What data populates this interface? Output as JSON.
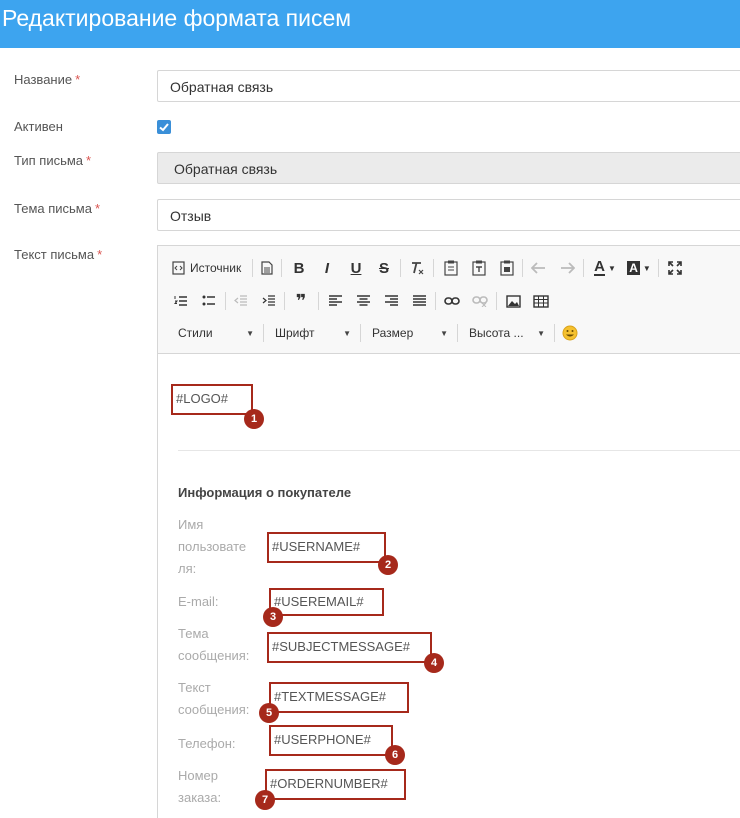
{
  "page": {
    "title": "Редактирование формата писем"
  },
  "form": {
    "name_label": "Название",
    "name_value": "Обратная связь",
    "active_label": "Активен",
    "active_checked": true,
    "type_label": "Тип письма",
    "type_value": "Обратная связь",
    "subject_label": "Тема письма",
    "subject_value": "Отзыв",
    "body_label": "Текст письма",
    "required_mark": "*"
  },
  "editor": {
    "toolbar": {
      "source_label": "Источник",
      "styles_label": "Стили",
      "font_label": "Шрифт",
      "size_label": "Размер",
      "height_label": "Высота ...",
      "bold": "B",
      "italic": "I",
      "underline": "U",
      "strike": "S",
      "quote": "❞",
      "text_color": "A",
      "bg_color": "A",
      "accent_color": "#3da4ef"
    },
    "content": {
      "logo": "#LOGO#",
      "section_title": "Информация о покупателе",
      "rows": [
        {
          "label_lines": [
            "Имя",
            "пользовате",
            "ля:"
          ],
          "placeholder": "#USERNAME#",
          "badge": "2"
        },
        {
          "label_lines": [
            "E-mail:"
          ],
          "placeholder": "#USEREMAIL#",
          "badge": "3"
        },
        {
          "label_lines": [
            "Тема",
            "сообщения:"
          ],
          "placeholder": "#SUBJECTMESSAGE#",
          "badge": "4"
        },
        {
          "label_lines": [
            "Текст",
            "сообщения:"
          ],
          "placeholder": "#TEXTMESSAGE#",
          "badge": "5"
        },
        {
          "label_lines": [
            "Телефон:"
          ],
          "placeholder": "#USERPHONE#",
          "badge": "6"
        },
        {
          "label_lines": [
            "Номер",
            "заказа:"
          ],
          "placeholder": "#ORDERNUMBER#",
          "badge": "7"
        }
      ],
      "logo_badge": "1",
      "marker_color": "#a6291b"
    }
  }
}
